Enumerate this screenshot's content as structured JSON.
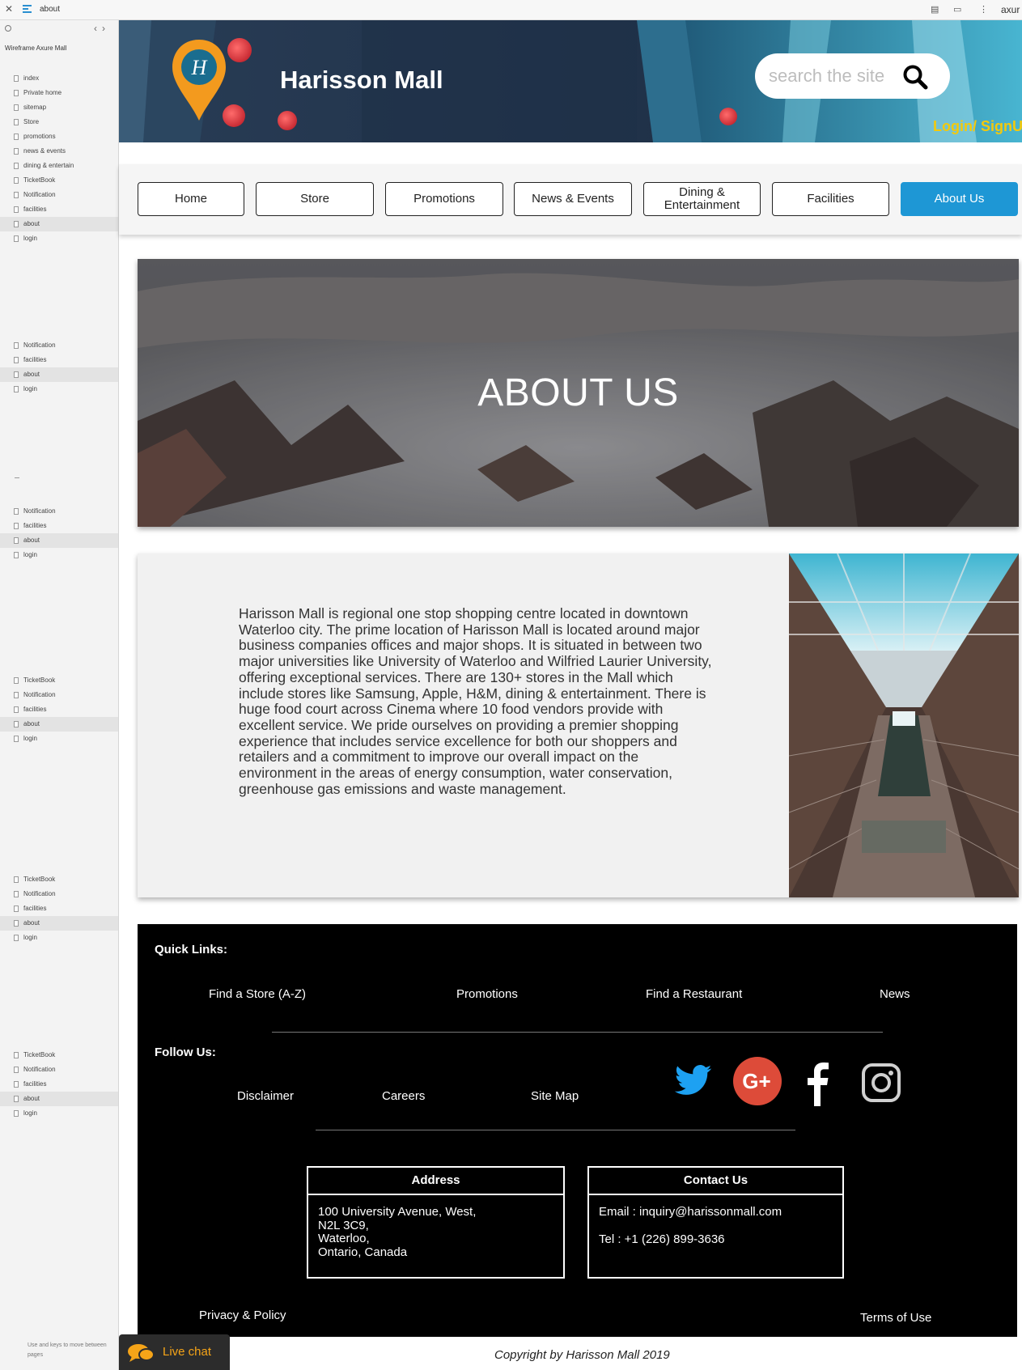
{
  "viewer": {
    "page_name": "about",
    "brand": "axur",
    "project_title": "Wireframe Axure Mall",
    "nav_hint": "Use  and  keys to move between pages",
    "sidebar_groups": [
      [
        "index",
        "Private home",
        "sitemap",
        "Store",
        "promotions",
        "news & events",
        "dining & entertain",
        "TicketBook",
        "Notification",
        "facilities",
        "about",
        "login"
      ],
      [
        "Notification",
        "facilities",
        "about",
        "login"
      ],
      [
        "Notification",
        "facilities",
        "about",
        "login"
      ],
      [
        "TicketBook",
        "Notification",
        "facilities",
        "about",
        "login"
      ],
      [
        "TicketBook",
        "Notification",
        "facilities",
        "about",
        "login"
      ],
      [
        "TicketBook",
        "Notification",
        "facilities",
        "about",
        "login"
      ]
    ],
    "active_page": "about"
  },
  "header": {
    "site_title": "Harisson Mall",
    "search_placeholder": "search the site",
    "login_label": "Login/ SignU",
    "logo_letter": "H"
  },
  "nav": {
    "items": [
      "Home",
      "Store",
      "Promotions",
      "News & Events",
      "Dining & Entertainment",
      "Facilities",
      "About Us"
    ],
    "active": "About Us"
  },
  "hero": {
    "title": "ABOUT US"
  },
  "about": {
    "text": "Harisson Mall is regional one stop shopping centre located in downtown Waterloo city. The prime location of Harisson Mall is located around major business companies offices and major shops. It is situated in between two major universities like University of Waterloo and Wilfried Laurier University, offering exceptional services. There are 130+ stores in the Mall which include stores like Samsung, Apple, H&M, dining & entertainment. There is huge food court across Cinema where 10 food vendors provide with excellent service. We pride ourselves on providing a premier shopping experience that includes service excellence for both our shoppers and retailers and a commitment to improve our overall impact on the environment in the areas of energy consumption, water conservation, greenhouse gas emissions and waste management."
  },
  "footer": {
    "quick_links_label": "Quick Links:",
    "quick_links": [
      "Find a Store (A-Z)",
      "Promotions",
      "Find a Restaurant",
      "News"
    ],
    "follow_label": "Follow Us:",
    "secondary_links": [
      "Disclaimer",
      "Careers",
      "Site Map"
    ],
    "social": [
      "twitter-icon",
      "google-plus-icon",
      "facebook-icon",
      "instagram-icon"
    ],
    "social_colors": {
      "twitter": "#1da1f2",
      "google_plus": "#dd4b39"
    },
    "address": {
      "heading": "Address",
      "lines": [
        "100 University Avenue, West,",
        "N2L 3C9,",
        "Waterloo,",
        "Ontario, Canada"
      ]
    },
    "contact": {
      "heading": "Contact Us",
      "email": "Email : inquiry@harissonmall.com",
      "tel": "Tel : +1 (226) 899-3636"
    },
    "privacy": "Privacy & Policy",
    "terms": "Terms of Use"
  },
  "copyright": "Copyright by Harisson Mall  2019",
  "live_chat": "Live chat",
  "colors": {
    "accent": "#1e97d5",
    "login": "#f3c90c",
    "logo": "#f39a1e",
    "chat": "#f5a418"
  }
}
